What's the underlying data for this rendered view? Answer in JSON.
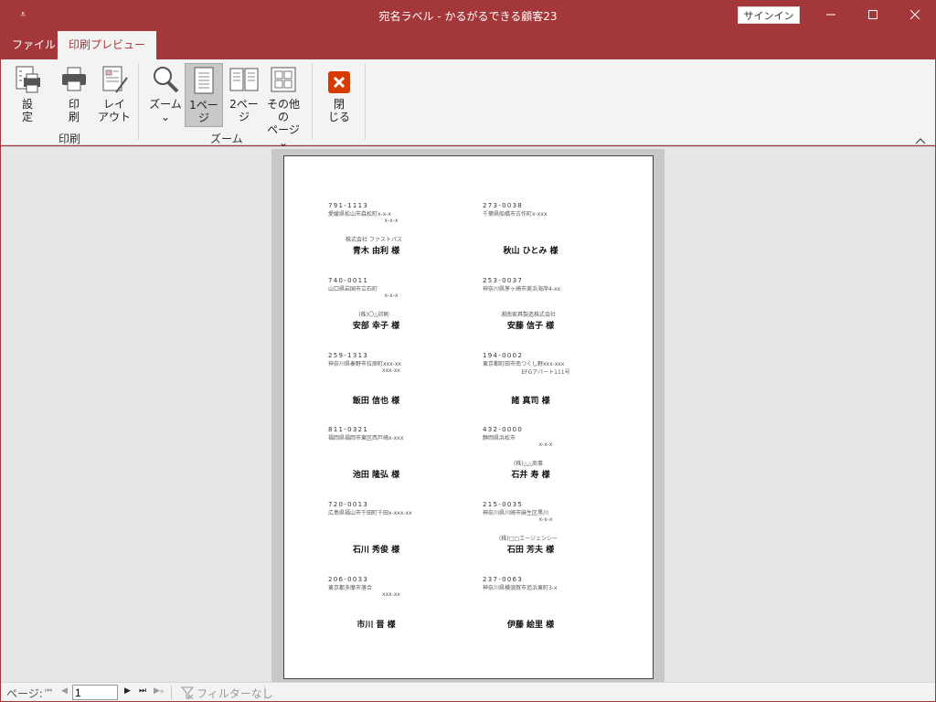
{
  "app": {
    "title": "宛名ラベル  -  かるがるできる顧客23",
    "signin_label": "サインイン",
    "qat_symbol": "⩡"
  },
  "tabs": [
    {
      "label": "ファイル",
      "active": false
    },
    {
      "label": "印刷プレビュー",
      "active": true
    }
  ],
  "ribbon": {
    "print_group": {
      "label": "印刷",
      "setup_label_1": "設",
      "setup_label_2": "定",
      "print_label_1": "印",
      "print_label_2": "刷",
      "layout_label_1": "レイ",
      "layout_label_2": "アウト"
    },
    "zoom_group": {
      "label": "ズーム",
      "zoom_label": "ズーム",
      "zoom_arrow": "⌄",
      "one_page_1": "1ペー",
      "one_page_2": "ジ",
      "two_page_1": "2ペー",
      "two_page_2": "ジ",
      "other_1": "その他の",
      "other_2": "ページ ⌄"
    },
    "close_group": {
      "close_label_1": "閉",
      "close_label_2": "じる"
    },
    "accent_close": "#d83b01"
  },
  "labels": [
    {
      "zip": "791-1113",
      "addr1": "愛媛県松山市森松町x-x-x",
      "addr2": "x-x-x",
      "company": "株式会社 ファストパス",
      "name": "青木 由利 様"
    },
    {
      "zip": "273-0038",
      "addr1": "千葉県船橋市古作町x-xxx",
      "addr2": "",
      "company": "",
      "name": "秋山 ひとみ 様"
    },
    {
      "zip": "740-0011",
      "addr1": "山口県岩国市立石町",
      "addr2": "x-x-x",
      "company": "(株)〇△印刷",
      "name": "安部 幸子 様"
    },
    {
      "zip": "253-0037",
      "addr1": "神奈川県茅ヶ崎市美浜海岸4-xx",
      "addr2": "",
      "company": "湘南家具製造株式会社",
      "name": "安藤 信子 様"
    },
    {
      "zip": "259-1313",
      "addr1": "神奈川県秦野市拉原町xxx-xx",
      "addr2": "xxx-xx",
      "company": "",
      "name": "飯田 信也 様"
    },
    {
      "zip": "194-0002",
      "addr1": "東京都町田市南つくし野xxx-xxx",
      "addr2": "EFGアパート111号",
      "company": "",
      "name": "諸 真司 様"
    },
    {
      "zip": "811-0321",
      "addr1": "福岡県福岡市東区西戸崎x-xxx",
      "addr2": "",
      "company": "",
      "name": "池田 隆弘 様"
    },
    {
      "zip": "432-0000",
      "addr1": "静岡県浜松市",
      "addr2": "x-x-x",
      "company": "(株)△△商事",
      "name": "石井 寿 様"
    },
    {
      "zip": "720-0013",
      "addr1": "広島県福山市千田町千田x-xxx-xx",
      "addr2": "",
      "company": "",
      "name": "石川 秀俊 様"
    },
    {
      "zip": "215-0035",
      "addr1": "神奈川県川崎市麻生区黒川",
      "addr2": "x-x-x",
      "company": "(株)□□エージェンシー",
      "name": "石田 芳夫 様"
    },
    {
      "zip": "206-0033",
      "addr1": "東京都多摩市落合",
      "addr2": "xxx-xx",
      "company": "",
      "name": "市川 晋 様"
    },
    {
      "zip": "237-0063",
      "addr1": "神奈川県横須賀市追浜東町3-x",
      "addr2": "",
      "company": "",
      "name": "伊藤 絵里 様"
    }
  ],
  "status": {
    "page_label": "ページ:",
    "page_value": "1",
    "nav_first": "⏮",
    "nav_prev": "◀",
    "nav_next": "▶",
    "nav_last": "⏭",
    "nav_new": "▶⁎",
    "filter_label": "フィルターなし"
  }
}
